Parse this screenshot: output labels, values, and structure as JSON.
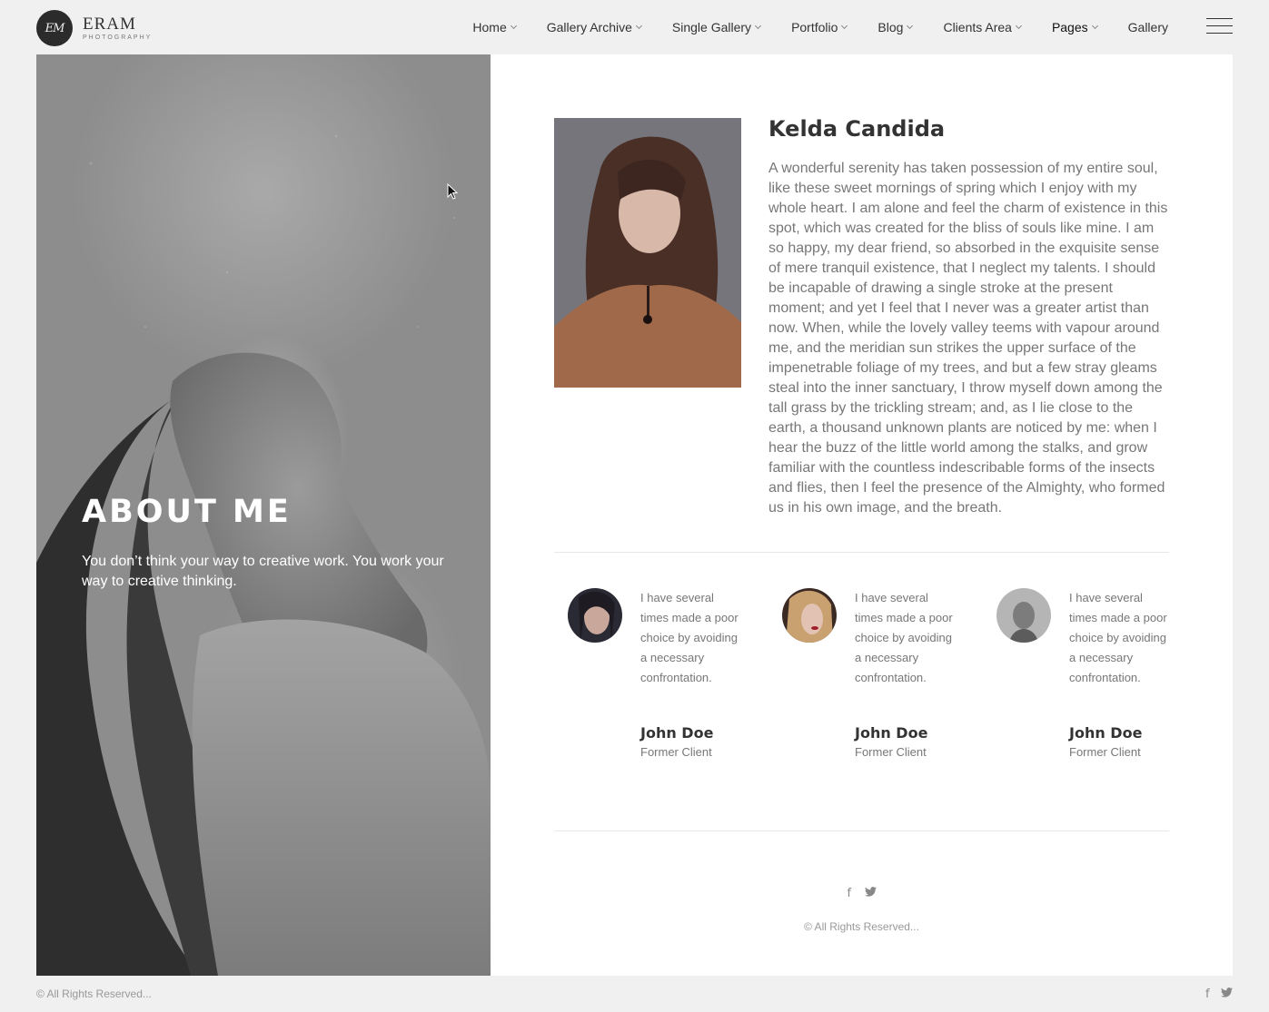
{
  "logo": {
    "mark": "EM",
    "name": "ERAM",
    "subtitle": "PHOTOGRAPHY"
  },
  "nav": {
    "items": [
      {
        "label": "Home",
        "has_dropdown": true
      },
      {
        "label": "Gallery Archive",
        "has_dropdown": true
      },
      {
        "label": "Single Gallery",
        "has_dropdown": true
      },
      {
        "label": "Portfolio",
        "has_dropdown": true
      },
      {
        "label": "Blog",
        "has_dropdown": true
      },
      {
        "label": "Clients Area",
        "has_dropdown": true
      },
      {
        "label": "Pages",
        "has_dropdown": true,
        "current": true
      },
      {
        "label": "Gallery",
        "has_dropdown": false
      }
    ],
    "menu_icon": "hamburger-icon"
  },
  "hero": {
    "title": "ABOUT ME",
    "tagline": "You don’t think your way to creative work. You work your way to creative thinking."
  },
  "bio": {
    "name": "Kelda Candida",
    "text": "A wonderful serenity has taken possession of my entire soul, like these sweet mornings of spring which I enjoy with my whole heart. I am alone and feel the charm of existence in this spot, which was created for the bliss of souls like mine. I am so happy, my dear friend, so absorbed in the exquisite sense of mere tranquil existence, that I neglect my talents. I should be incapable of drawing a single stroke at the present moment; and yet I feel that I never was a greater artist than now. When, while the lovely valley teems with vapour around me, and the meridian sun strikes the upper surface of the impenetrable foliage of my trees, and but a few stray gleams steal into the inner sanctuary, I throw myself down among the tall grass by the trickling stream; and, as I lie close to the earth, a thousand unknown plants are noticed by me: when I hear the buzz of the little world among the stalks, and grow familiar with the countless indescribable forms of the insects and flies, then I feel the presence of the Almighty, who formed us in his own image, and the breath."
  },
  "testimonials": [
    {
      "quote": "I have several times made a poor choice by avoiding a necessary confrontation.",
      "name": "John Doe",
      "role": "Former Client"
    },
    {
      "quote": "I have several times made a poor choice by avoiding a necessary confrontation.",
      "name": "John Doe",
      "role": "Former Client"
    },
    {
      "quote": "I have several times made a poor choice by avoiding a necessary confrontation.",
      "name": "John Doe",
      "role": "Former Client"
    }
  ],
  "footer": {
    "social": [
      {
        "icon": "facebook-icon",
        "glyph": "f"
      },
      {
        "icon": "twitter-icon",
        "glyph": "🐦"
      }
    ],
    "copyright": "© All Rights Reserved..."
  },
  "bottom_bar": {
    "copyright": "© All Rights Reserved..."
  },
  "colors": {
    "background": "#f0f0f0",
    "panel": "#ffffff",
    "heading": "#333333",
    "body_text": "#777777"
  }
}
